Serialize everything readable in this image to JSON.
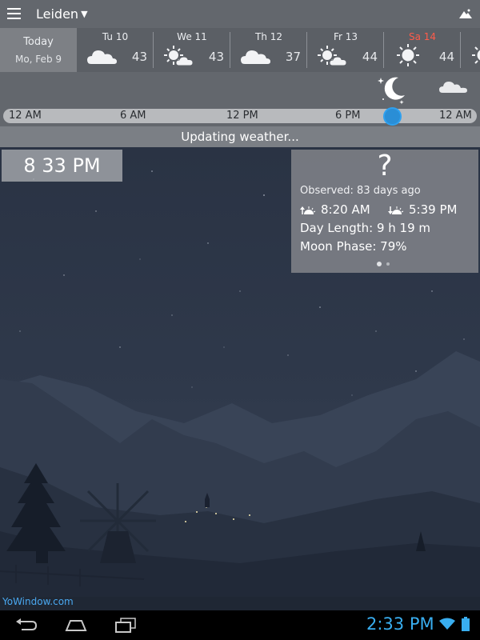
{
  "app": {
    "location": "Leiden"
  },
  "forecast": {
    "today": {
      "label": "Today",
      "date": "Mo, Feb 9"
    },
    "days": [
      {
        "name": "Tu 10",
        "temp": "43",
        "icon": "cloud-icon",
        "highlight": false
      },
      {
        "name": "We 11",
        "temp": "43",
        "icon": "partly-sunny-icon",
        "highlight": false
      },
      {
        "name": "Th 12",
        "temp": "37",
        "icon": "cloud-icon",
        "highlight": false
      },
      {
        "name": "Fr 13",
        "temp": "44",
        "icon": "partly-sunny-icon",
        "highlight": false
      },
      {
        "name": "Sa 14",
        "temp": "44",
        "icon": "sun-icon",
        "highlight": true
      }
    ]
  },
  "timeline": {
    "ticks": [
      "12 AM",
      "6 AM",
      "12 PM",
      "6 PM",
      "12 AM"
    ]
  },
  "status": {
    "text": "Updating weather..."
  },
  "clock": {
    "time": "8  33 PM"
  },
  "card": {
    "condition": "?",
    "observed": "Observed: 83 days ago",
    "sunrise": "8:20 AM",
    "sunset": "5:39 PM",
    "day_length": "Day Length: 9 h 19 m",
    "moon_phase": "Moon Phase: 79%"
  },
  "brand": {
    "text": "YoWindow.com"
  },
  "system": {
    "time": "2:33 PM"
  },
  "colors": {
    "accent_blue": "#2a8ed6",
    "weekend_red": "#ff5b4a",
    "system_blue": "#39aef0"
  }
}
